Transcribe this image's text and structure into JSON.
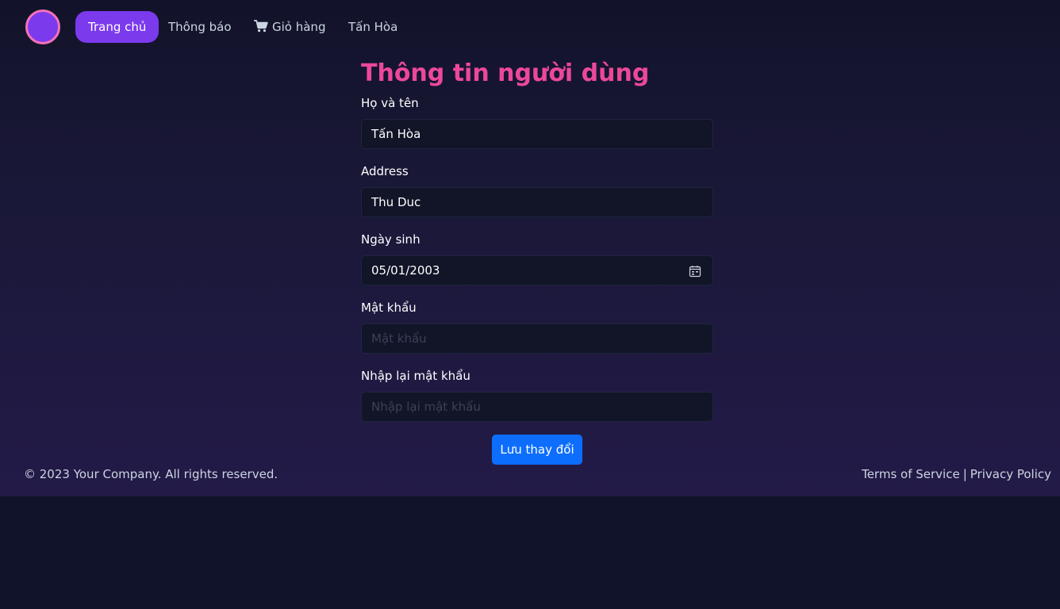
{
  "nav": {
    "home": "Trang chủ",
    "notifications": "Thông báo",
    "cart": "Giỏ hàng",
    "user": "Tấn Hòa"
  },
  "form": {
    "title": "Thông tin người dùng",
    "fullname": {
      "label": "Họ và tên",
      "value": "Tấn Hòa"
    },
    "address": {
      "label": "Address",
      "value": "Thu Duc"
    },
    "birthday": {
      "label": "Ngày sinh",
      "value": "05/01/2003"
    },
    "password": {
      "label": "Mật khẩu",
      "placeholder": "Mật khẩu"
    },
    "confirm_password": {
      "label": "Nhập lại mật khẩu",
      "placeholder": "Nhập lại mật khẩu"
    },
    "save_label": "Lưu thay đổi"
  },
  "footer": {
    "copyright": "© 2023 Your Company. All rights reserved.",
    "terms": "Terms of Service",
    "separator": "|",
    "privacy": "Privacy Policy"
  },
  "colors": {
    "accent": "#7c3aed",
    "title": "#ec4899",
    "button": "#0d6efd",
    "logo_border": "#f472b6"
  },
  "icons": {
    "cart": "cart-icon",
    "calendar": "calendar-icon",
    "logo": "logo"
  }
}
